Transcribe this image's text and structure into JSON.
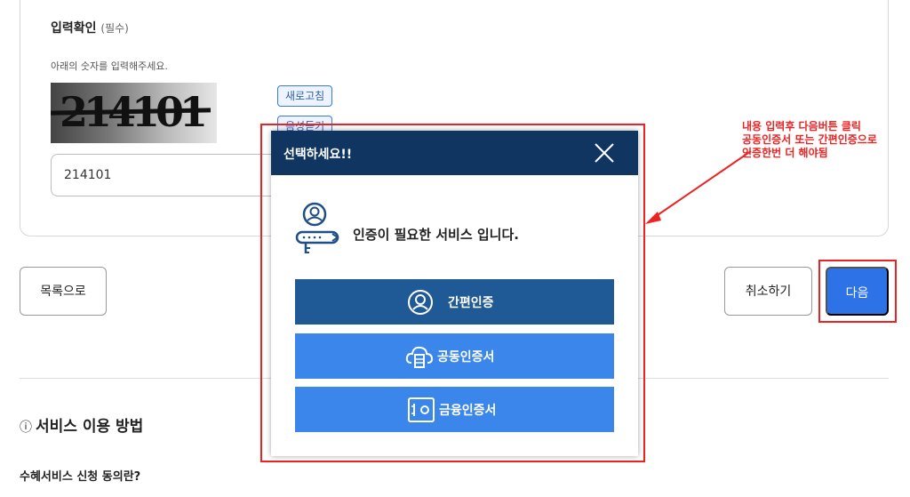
{
  "captcha": {
    "title": "입력확인",
    "required": "(필수)",
    "description": "아래의 숫자를 입력해주세요.",
    "image_digits": "214101",
    "refresh_label": "새로고침",
    "audio_label": "음성듣기",
    "input_value": "214101"
  },
  "footer_buttons": {
    "list_label": "목록으로",
    "cancel_label": "취소하기",
    "next_label": "다음"
  },
  "howto": {
    "title": "서비스 이용 방법",
    "info_glyph": "ⓘ",
    "subtitle": "수혜서비스 신청 동의란?"
  },
  "modal": {
    "title": "선택하세요!!",
    "message": "인증이 필요한 서비스 입니다.",
    "buttons": [
      {
        "label": "간편인증",
        "icon": "person-circle-icon"
      },
      {
        "label": "공동인증서",
        "icon": "cloud-server-icon"
      },
      {
        "label": "금융인증서",
        "icon": "safe-icon"
      }
    ]
  },
  "annotation": {
    "line1": "내용 입력후 다음버튼 클릭",
    "line2": "공동인증서 또는 간편인증으로",
    "line3": "인증한번 더 해야됨"
  },
  "colors": {
    "modal_header": "#0f3560",
    "primary_button": "#2e72e8",
    "simple_auth_button": "#1f5a97",
    "cert_button": "#3b86ea",
    "annotation_red": "#e22222"
  }
}
